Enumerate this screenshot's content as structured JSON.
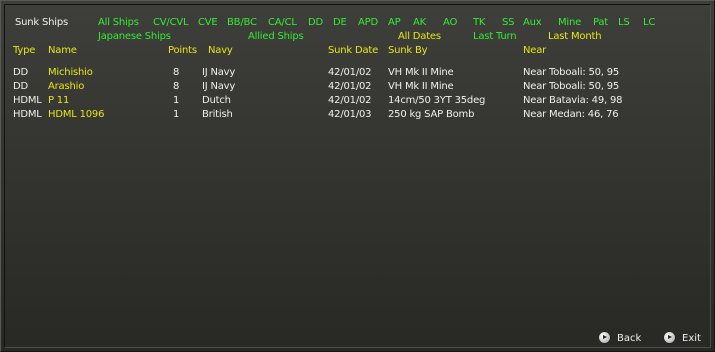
{
  "title": "Sunk Ships",
  "filters_row1": [
    "All Ships",
    "CV/CVL",
    "CVE",
    "BB/BC",
    "CA/CL",
    "DD",
    "DE",
    "APD",
    "AP",
    "AK",
    "AO",
    "TK",
    "SS",
    "Aux",
    "Mine",
    "Pat",
    "LS",
    "LC"
  ],
  "filters_row2": {
    "japanese": "Japanese Ships",
    "allied": "Allied Ships",
    "all_dates": "All Dates",
    "last_turn": "Last Turn",
    "last_month": "Last Month"
  },
  "columns": {
    "type": "Type",
    "name": "Name",
    "points": "Points",
    "navy": "Navy",
    "sunk_date": "Sunk Date",
    "sunk_by": "Sunk By",
    "near": "Near"
  },
  "rows": [
    {
      "type": "DD",
      "name": "Michishio",
      "points": "8",
      "navy": "IJ Navy",
      "sunk_date": "42/01/02",
      "sunk_by": "VH Mk II Mine",
      "near": "Near Toboali: 50, 95"
    },
    {
      "type": "DD",
      "name": "Arashio",
      "points": "8",
      "navy": "IJ Navy",
      "sunk_date": "42/01/02",
      "sunk_by": "VH Mk II Mine",
      "near": "Near Toboali: 50, 95"
    },
    {
      "type": "HDML",
      "name": "P 11",
      "points": "1",
      "navy": "Dutch",
      "sunk_date": "42/01/02",
      "sunk_by": "14cm/50 3YT 35deg",
      "near": "Near Batavia: 49, 98"
    },
    {
      "type": "HDML",
      "name": "HDML 1096",
      "points": "1",
      "navy": "British",
      "sunk_date": "42/01/03",
      "sunk_by": "250 kg SAP Bomb",
      "near": "Near Medan: 46, 76"
    }
  ],
  "buttons": {
    "back": "Back",
    "exit": "Exit"
  }
}
